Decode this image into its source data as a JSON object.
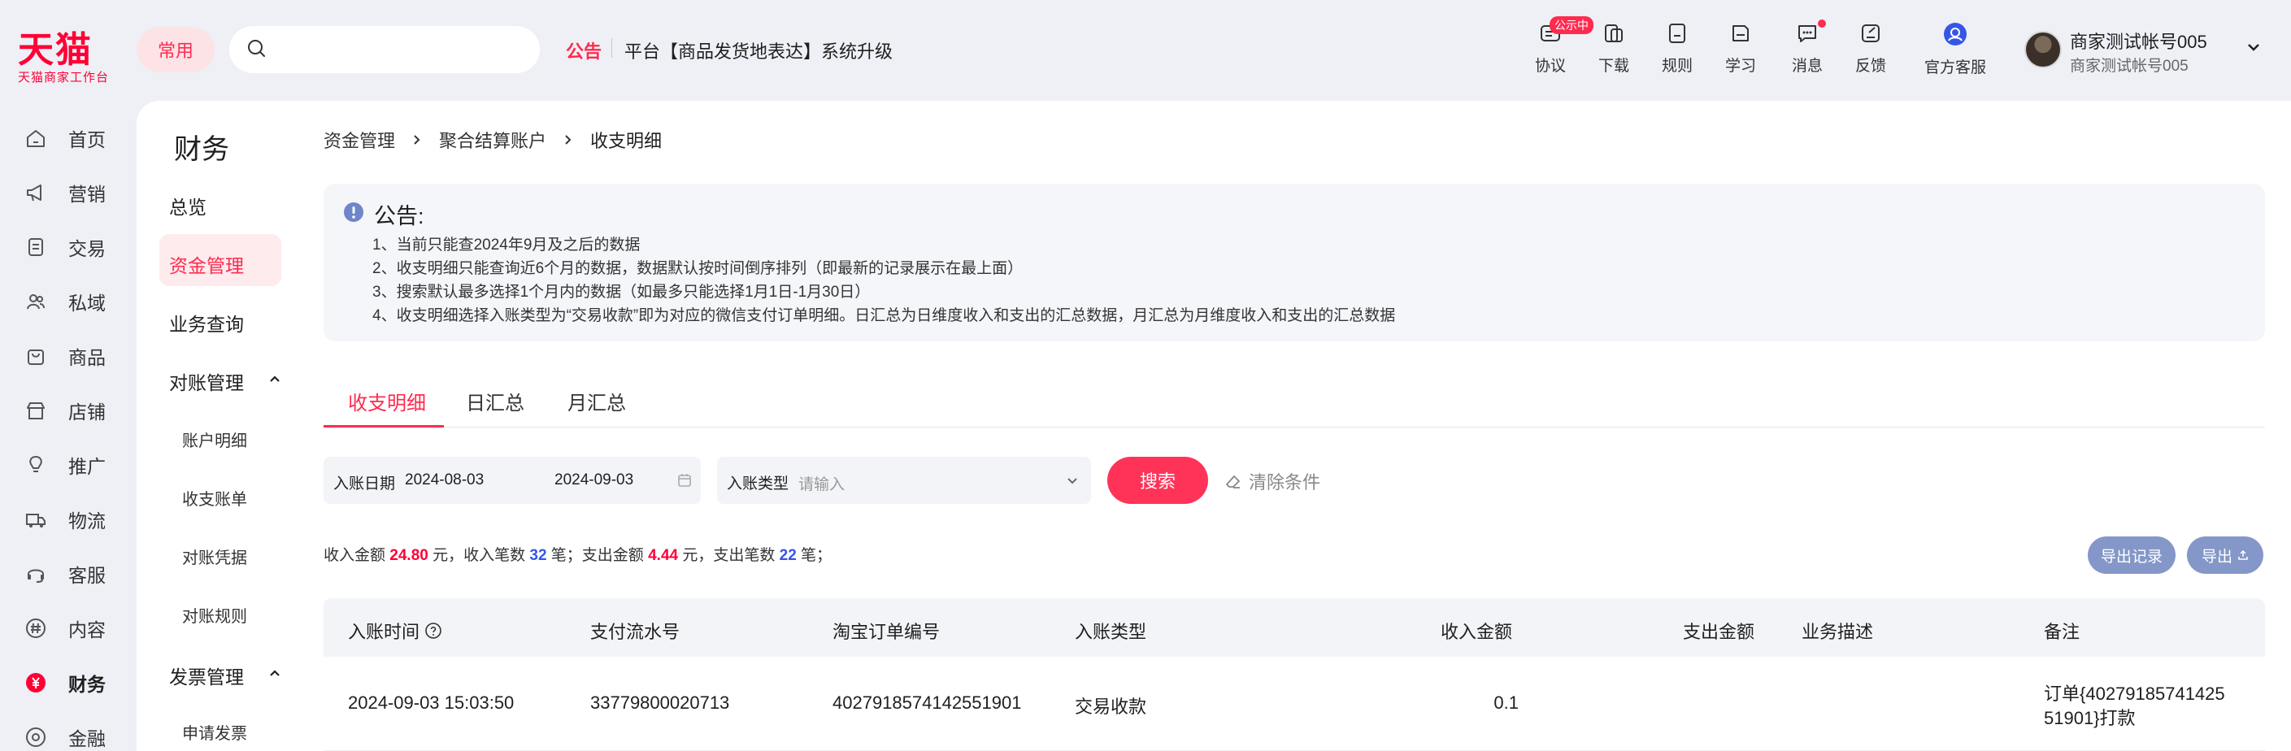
{
  "logo": {
    "main": "天猫",
    "sub": "天猫商家工作台"
  },
  "header": {
    "common_label": "常用",
    "search": {
      "placeholder": ""
    },
    "notice_head": "公告",
    "notice_text": "平台【商品发货地表达】系统升级",
    "icons": [
      {
        "label": "协议",
        "icon": "agreement-icon",
        "badge": "公示中"
      },
      {
        "label": "下载",
        "icon": "download-icon"
      },
      {
        "label": "规则",
        "icon": "rules-icon"
      },
      {
        "label": "学习",
        "icon": "learn-icon"
      },
      {
        "label": "消息",
        "icon": "message-icon",
        "dot": true
      },
      {
        "label": "反馈",
        "icon": "feedback-icon"
      },
      {
        "label": "官方客服",
        "icon": "customer-service-icon"
      }
    ],
    "account": {
      "name": "商家测试帐号005",
      "sub": "商家测试帐号005"
    }
  },
  "leftnav": {
    "items": [
      {
        "label": "首页",
        "icon": "home-icon"
      },
      {
        "label": "营销",
        "icon": "megaphone-icon"
      },
      {
        "label": "交易",
        "icon": "order-icon"
      },
      {
        "label": "私域",
        "icon": "users-icon"
      },
      {
        "label": "商品",
        "icon": "bag-icon"
      },
      {
        "label": "店铺",
        "icon": "store-icon"
      },
      {
        "label": "推广",
        "icon": "bulb-icon"
      },
      {
        "label": "物流",
        "icon": "truck-icon"
      },
      {
        "label": "客服",
        "icon": "headset-icon"
      },
      {
        "label": "内容",
        "icon": "hash-icon"
      },
      {
        "label": "财务",
        "icon": "yuan-icon",
        "active": true
      },
      {
        "label": "金融",
        "icon": "finance-icon"
      }
    ]
  },
  "subnav": {
    "title": "财务",
    "items": {
      "overview": "总览",
      "fund": "资金管理",
      "business": "业务查询",
      "reconcile": "对账管理",
      "account_detail": "账户明细",
      "income_bill": "收支账单",
      "voucher": "对账凭据",
      "rules": "对账规则",
      "invoice": "发票管理",
      "apply_invoice": "申请发票"
    }
  },
  "breadcrumb": [
    "资金管理",
    "聚合结算账户",
    "收支明细"
  ],
  "announcement": {
    "title": "公告:",
    "lines": [
      "1、当前只能查2024年9月及之后的数据",
      "2、收支明细只能查询近6个月的数据，数据默认按时间倒序排列（即最新的记录展示在最上面）",
      "3、搜索默认最多选择1个月内的数据（如最多只能选择1月1日-1月30日）",
      "4、收支明细选择入账类型为“交易收款”即为对应的微信支付订单明细。日汇总为日维度收入和支出的汇总数据，月汇总为月维度收入和支出的汇总数据"
    ]
  },
  "tabs": [
    "收支明细",
    "日汇总",
    "月汇总"
  ],
  "filters": {
    "date_label": "入账日期",
    "date_start": "2024-08-03",
    "date_end": "2024-09-03",
    "type_label": "入账类型",
    "type_placeholder": "请输入",
    "search_label": "搜索",
    "clear_label": "清除条件"
  },
  "summary": {
    "p1": "收入金额 ",
    "income_amount": "24.80",
    "p2": " 元，收入笔数 ",
    "income_count": "32",
    "p3": " 笔；支出金额 ",
    "expense_amount": "4.44",
    "p4": " 元，支出笔数 ",
    "expense_count": "22",
    "p5": " 笔；"
  },
  "actions": {
    "export_records": "导出记录",
    "export": "导出"
  },
  "table": {
    "headers": [
      "入账时间",
      "支付流水号",
      "淘宝订单编号",
      "入账类型",
      "收入金额",
      "支出金额",
      "业务描述",
      "备注"
    ],
    "rows": [
      {
        "time": "2024-09-03 15:03:50",
        "flow_no": "33779800020713",
        "order_no": "4027918574142551901",
        "type": "交易收款",
        "income": "0.1",
        "expense": "",
        "desc": "",
        "remark_1": "订单{40279185741425",
        "remark_2": "51901}打款"
      }
    ]
  },
  "colors": {
    "accent": "#ff2b4f",
    "blue": "#3656e8",
    "export_btn": "#8497c8"
  }
}
